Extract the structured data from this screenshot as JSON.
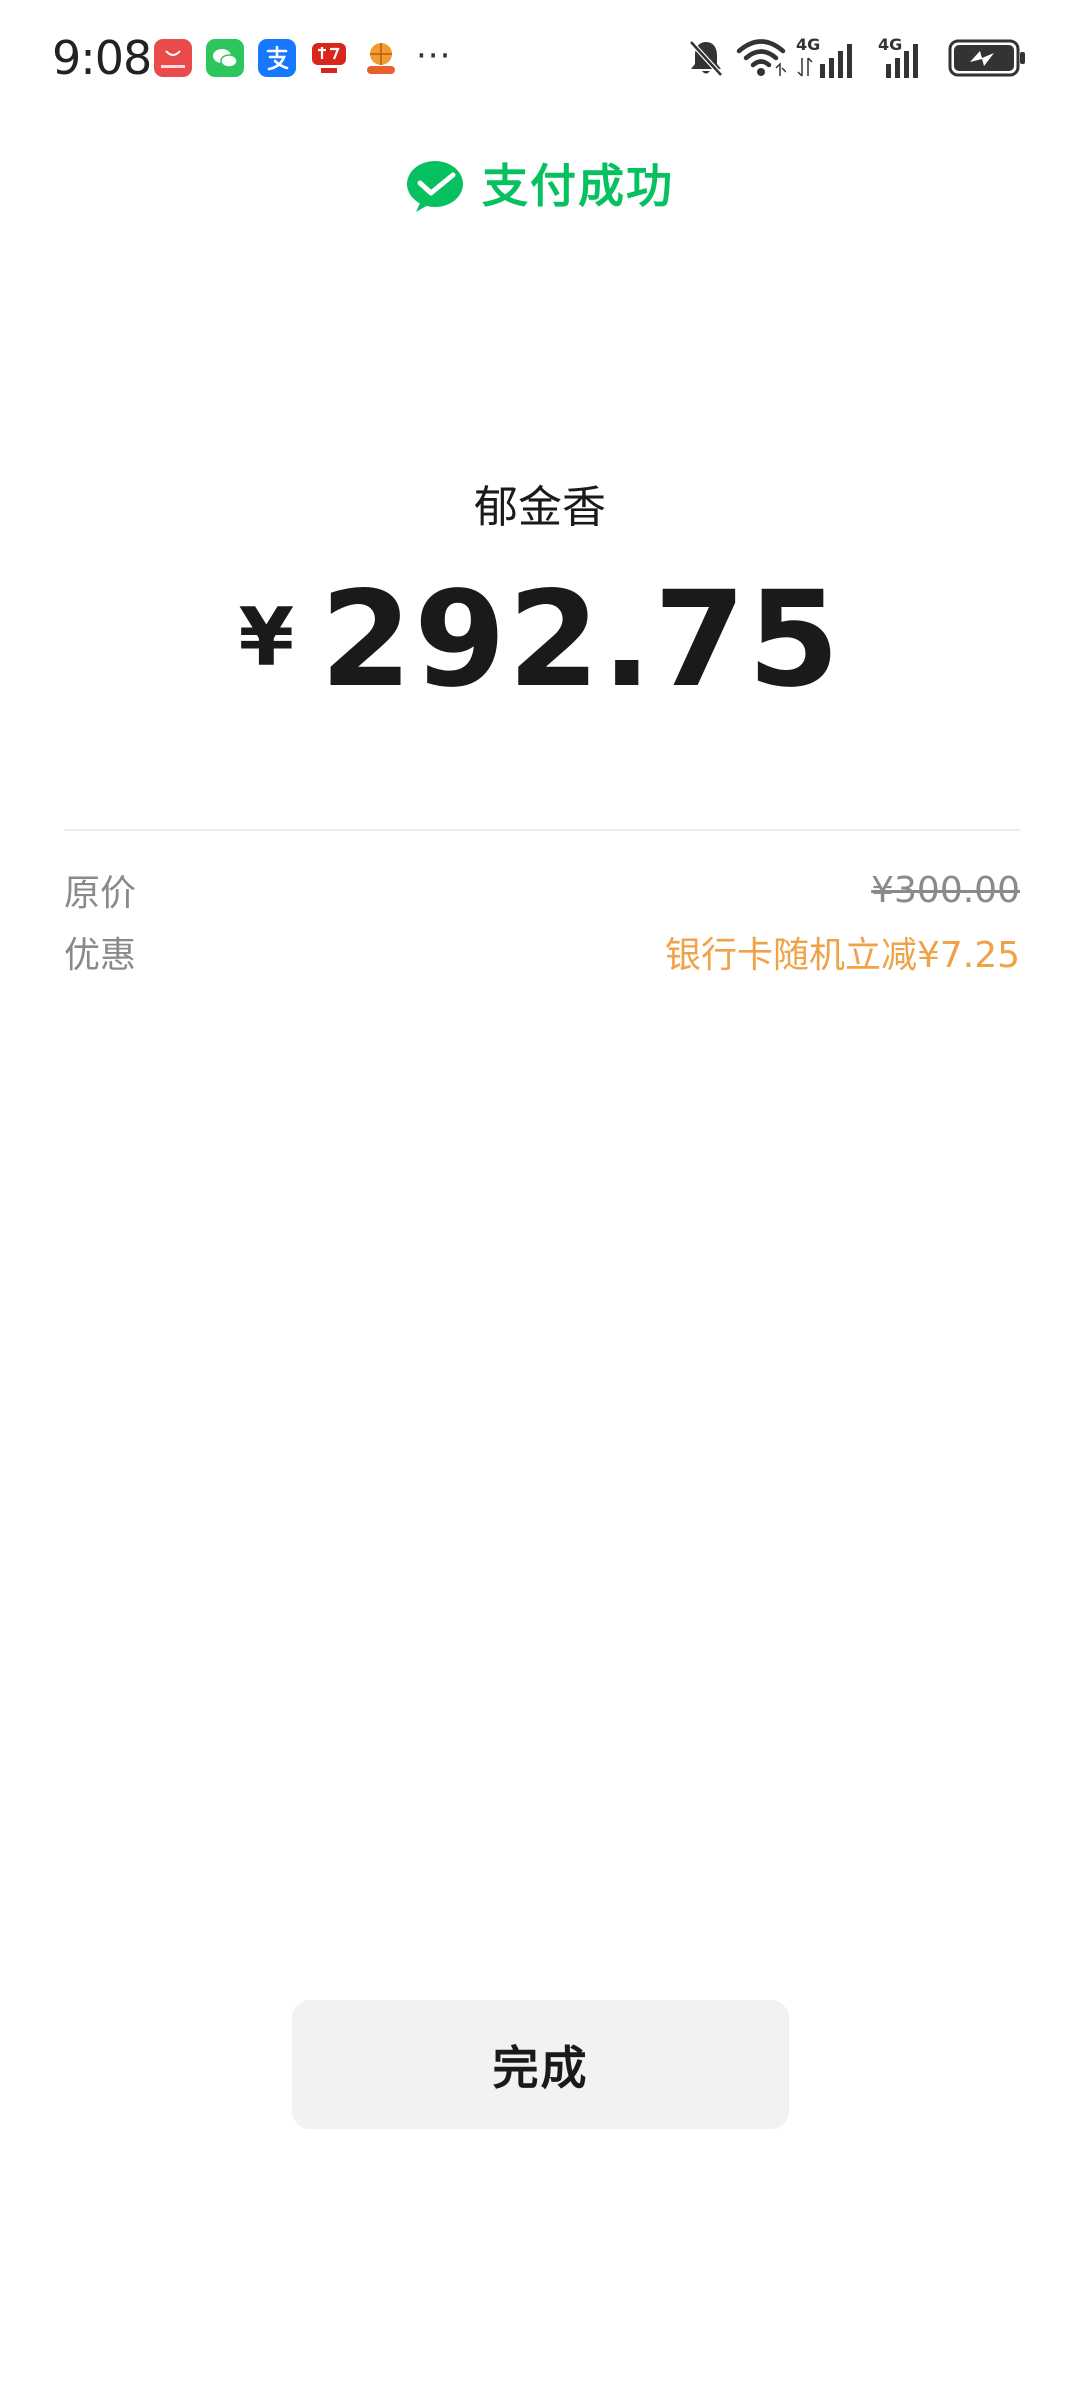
{
  "status_bar": {
    "time": "9:08",
    "notification_icons": [
      "huawei-appgallery-icon",
      "wechat-icon",
      "alipay-icon",
      "shopping-app-icon",
      "basketball-app-icon"
    ],
    "more": "···",
    "system_icons": [
      "bell-off-icon",
      "wifi-icon",
      "4g-signal-icon",
      "4g-signal-icon",
      "battery-charging-icon"
    ],
    "signal_label": "4G"
  },
  "header": {
    "title": "支付成功",
    "accent_color": "#07c160"
  },
  "payment": {
    "merchant": "郁金香",
    "currency": "¥",
    "amount": "292.75"
  },
  "details": {
    "original_label": "原价",
    "original_value": "¥300.00",
    "discount_label": "优惠",
    "discount_value": "银行卡随机立减¥7.25",
    "discount_color": "#f0a248"
  },
  "actions": {
    "done_label": "完成"
  }
}
